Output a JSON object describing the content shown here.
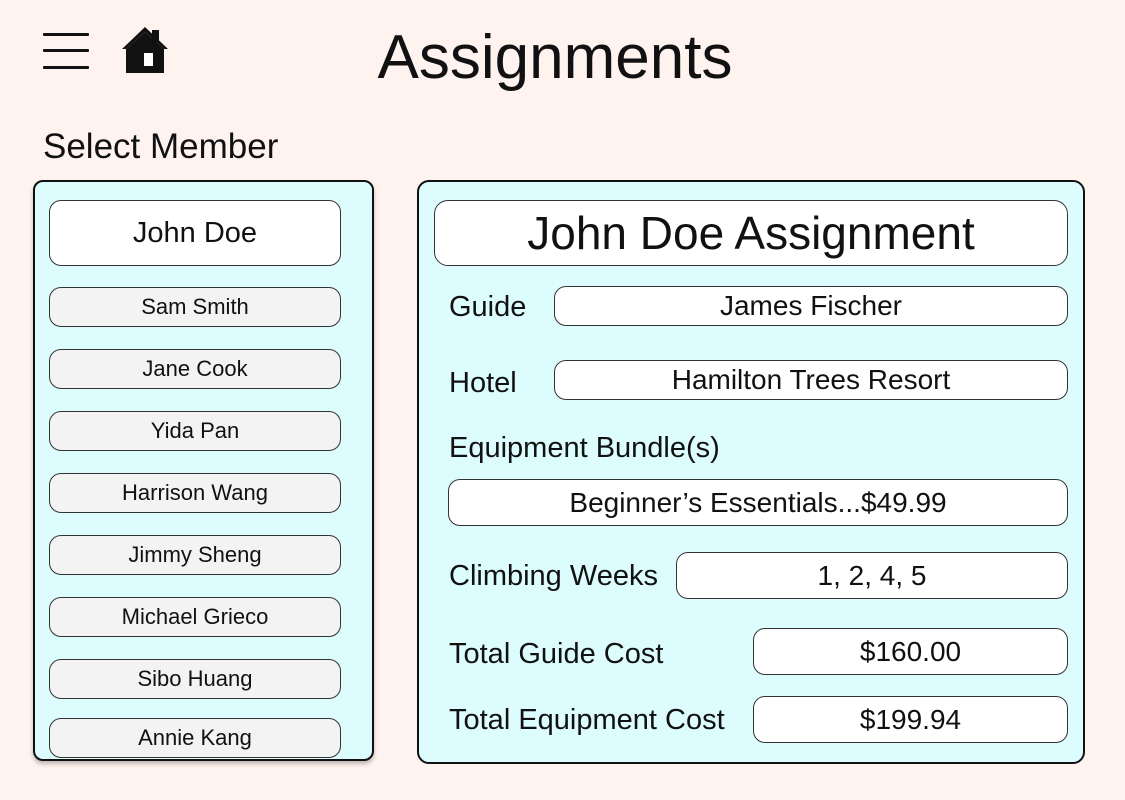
{
  "header": {
    "title": "Assignments",
    "menu_icon": "hamburger-menu-icon",
    "home_icon": "home-icon"
  },
  "member_select": {
    "label": "Select Member",
    "selected": "John Doe",
    "members": [
      "Sam Smith",
      "Jane Cook",
      "Yida Pan",
      "Harrison Wang",
      "Jimmy Sheng",
      "Michael Grieco",
      "Sibo Huang",
      "Annie Kang"
    ]
  },
  "assignment": {
    "title": "John Doe Assignment",
    "guide_label": "Guide",
    "guide_value": "James Fischer",
    "hotel_label": "Hotel",
    "hotel_value": "Hamilton Trees Resort",
    "equipment_label": "Equipment Bundle(s)",
    "equipment_value": "Beginner’s Essentials...$49.99",
    "weeks_label": "Climbing Weeks",
    "weeks_value": "1, 2, 4, 5",
    "guide_cost_label": "Total Guide Cost",
    "guide_cost_value": "$160.00",
    "equipment_cost_label": "Total Equipment Cost",
    "equipment_cost_value": "$199.94"
  },
  "colors": {
    "background": "#fff3f0",
    "panel": "#dcfcfd",
    "field": "#ffffff",
    "member_button": "#f3f3f3"
  }
}
